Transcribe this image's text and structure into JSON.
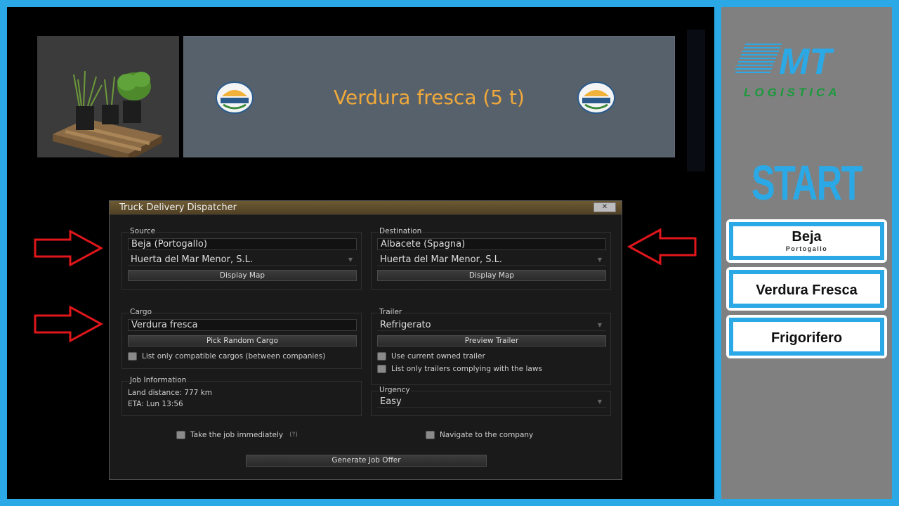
{
  "cargo_header": {
    "title": "Verdura fresca (5 t)"
  },
  "dialog": {
    "title": "Truck Delivery Dispatcher",
    "close_label": "✕",
    "source": {
      "label": "Source",
      "city": "Beja (Portogallo)",
      "company": "Huerta del Mar Menor, S.L.",
      "map_button": "Display Map"
    },
    "destination": {
      "label": "Destination",
      "city": "Albacete (Spagna)",
      "company": "Huerta del Mar Menor, S.L.",
      "map_button": "Display Map"
    },
    "cargo": {
      "label": "Cargo",
      "value": "Verdura fresca",
      "random_button": "Pick Random Cargo",
      "compatible_only": "List only compatible cargos (between companies)"
    },
    "trailer": {
      "label": "Trailer",
      "value": "Refrigerato",
      "preview_button": "Preview Trailer",
      "use_owned": "Use current owned trailer",
      "law_only": "List only trailers complying with the laws"
    },
    "job_info": {
      "label": "Job Information",
      "distance": "Land distance: 777 km",
      "eta": "ETA: Lun 13:56"
    },
    "urgency": {
      "label": "Urgency",
      "value": "Easy"
    },
    "take_immediately": "Take the job immediately",
    "take_hint": "(?)",
    "navigate": "Navigate to the company",
    "generate_button": "Generate Job Offer"
  },
  "sidebar": {
    "logo_top": "MT",
    "logo_bottom": "LOGISTICA",
    "start_label": "START",
    "cards": [
      {
        "title": "Beja",
        "subtitle": "Portogallo"
      },
      {
        "title": "Verdura Fresca"
      },
      {
        "title": "Frigorifero"
      }
    ]
  },
  "colors": {
    "frame": "#2ba9e6",
    "cargo_title": "#f0a93a",
    "arrow": "#e0161b",
    "logo_green": "#1a9a3b",
    "logo_red": "#d21e2b"
  }
}
